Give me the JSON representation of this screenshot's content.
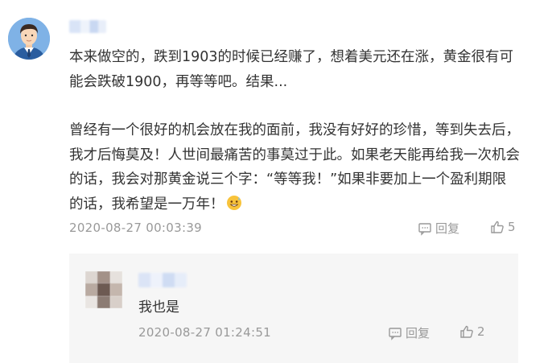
{
  "comment": {
    "paragraph1": "本来做空的，跌到1903的时候已经赚了，想着美元还在涨，黄金很有可能会跌破1900，再等等吧。结果...",
    "paragraph2": "曾经有一个很好的机会放在我的面前，我没有好好的珍惜，等到失去后，我才后悔莫及！人世间最痛苦的事莫过于此。如果老天能再给我一次机会的话，我会对那黄金说三个字：“等等我！”如果非要加上一个盈利期限的话，我希望是一万年！",
    "emoji": "sweat-grin-emoji",
    "timestamp": "2020-08-27 00:03:39",
    "reply_label": "回复",
    "like_count": "5"
  },
  "reply": {
    "text": "我也是",
    "timestamp": "2020-08-27 01:24:51",
    "reply_label": "回复",
    "like_count": "2"
  },
  "icons": {
    "reply": "comment-bubble-icon",
    "like": "thumbs-up-icon"
  },
  "colors": {
    "text": "#333333",
    "meta": "#999999",
    "reply_bg": "#f6f6f6",
    "avatar_bg": "#7fb2e6"
  }
}
